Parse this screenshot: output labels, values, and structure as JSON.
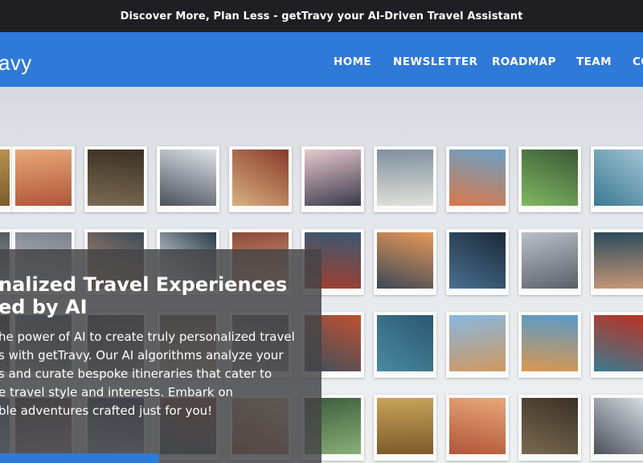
{
  "announcement": "Discover More, Plan Less - getTravy your AI-Driven Travel Assistant",
  "brand": {
    "logo_text": "avy"
  },
  "nav": [
    {
      "label": "HOME"
    },
    {
      "label": "NEWSLETTER"
    },
    {
      "label": "ROADMAP"
    },
    {
      "label": "TEAM"
    },
    {
      "label": "CO"
    }
  ],
  "hero": {
    "headline": "nalized Travel Experiences\ned by AI",
    "body": "he power of AI to create truly personalized travel\ns with getTravy. Our AI algorithms analyze your\ns and curate bespoke itineraries that cater to\ne travel style and interests. Embark on\nble adventures crafted just for you!"
  },
  "colors": {
    "announcement_bg": "#1f1f23",
    "nav_bg": "#2f79d8",
    "overlay_bg": "#444446",
    "text": "#ffffff"
  },
  "photos": [
    {
      "colors": [
        "#c9a35a",
        "#7a5a2a"
      ]
    },
    {
      "colors": [
        "#e8a878",
        "#b0553a"
      ]
    },
    {
      "colors": [
        "#3a3024",
        "#7a6a52"
      ]
    },
    {
      "colors": [
        "#dfe4ea",
        "#4a5058"
      ]
    },
    {
      "colors": [
        "#8a3a2a",
        "#d8b080"
      ]
    },
    {
      "colors": [
        "#e8c8d0",
        "#3a3a48"
      ]
    },
    {
      "colors": [
        "#8090a0",
        "#e0e0d8"
      ]
    },
    {
      "colors": [
        "#6aa0c8",
        "#d87848"
      ]
    },
    {
      "colors": [
        "#3a5838",
        "#80b860"
      ]
    },
    {
      "colors": [
        "#a8c8d8",
        "#3a7890"
      ]
    },
    {
      "colors": [
        "#505860",
        "#a8b0b8"
      ]
    },
    {
      "colors": [
        "#7a8088",
        "#c0c4c8"
      ]
    },
    {
      "colors": [
        "#3a4a5a",
        "#c0906a"
      ]
    },
    {
      "colors": [
        "#2a3a48",
        "#e8eef2"
      ]
    },
    {
      "colors": [
        "#8a4a38",
        "#e0a880"
      ]
    },
    {
      "colors": [
        "#3a5870",
        "#a04030"
      ]
    },
    {
      "colors": [
        "#e89858",
        "#3a4858"
      ]
    },
    {
      "colors": [
        "#1a2a38",
        "#4a7090"
      ]
    },
    {
      "colors": [
        "#b8c0c8",
        "#5a6068"
      ]
    },
    {
      "colors": [
        "#2a4a5a",
        "#c89878"
      ]
    },
    {
      "colors": [
        "#3a3a40",
        "#909090"
      ]
    },
    {
      "colors": [
        "#5a6068",
        "#b0b4b8"
      ]
    },
    {
      "colors": [
        "#4a4a4a",
        "#909090"
      ]
    },
    {
      "colors": [
        "#7a6a5a",
        "#c8b090"
      ]
    },
    {
      "colors": [
        "#5a5a5c",
        "#a0a0a0"
      ]
    },
    {
      "colors": [
        "#c05030",
        "#3a5060"
      ]
    },
    {
      "colors": [
        "#2a5870",
        "#4a8aa0"
      ]
    },
    {
      "colors": [
        "#88b8e0",
        "#d09860"
      ]
    },
    {
      "colors": [
        "#5a9ac8",
        "#d89850"
      ]
    },
    {
      "colors": [
        "#c03020",
        "#3a7a90"
      ]
    },
    {
      "colors": [
        "#3a5878",
        "#a0c0d8"
      ]
    },
    {
      "colors": [
        "#5a3a3a",
        "#c0a0a8"
      ]
    },
    {
      "colors": [
        "#2a3848",
        "#9ab8d0"
      ]
    },
    {
      "colors": [
        "#a04830",
        "#38586a"
      ]
    },
    {
      "colors": [
        "#e0c0a0",
        "#a05a38"
      ]
    },
    {
      "colors": [
        "#3a5a3a",
        "#8ab078"
      ]
    }
  ]
}
